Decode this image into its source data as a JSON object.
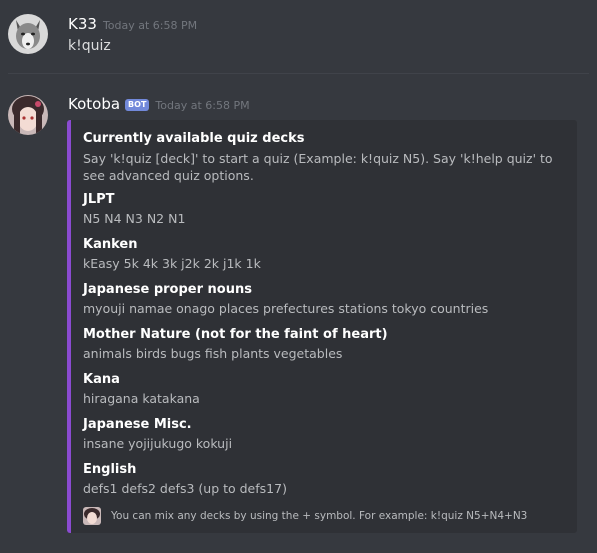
{
  "messages": [
    {
      "author": "K33",
      "timestamp": "Today at 6:58 PM",
      "content": "k!quiz"
    },
    {
      "author": "Kotoba",
      "bot_tag": "BOT",
      "timestamp": "Today at 6:58 PM"
    }
  ],
  "embed": {
    "accent_color": "#8b4bd1",
    "title": "Currently available quiz decks",
    "description": "Say 'k!quiz [deck]' to start a quiz (Example: k!quiz N5). Say 'k!help quiz' to see advanced quiz options.",
    "fields": [
      {
        "name": "JLPT",
        "value": "N5 N4 N3 N2 N1"
      },
      {
        "name": "Kanken",
        "value": "kEasy 5k 4k 3k j2k 2k j1k 1k"
      },
      {
        "name": "Japanese proper nouns",
        "value": "myouji namae onago places prefectures stations tokyo countries"
      },
      {
        "name": "Mother Nature (not for the faint of heart)",
        "value": "animals birds bugs fish plants vegetables"
      },
      {
        "name": "Kana",
        "value": "hiragana katakana"
      },
      {
        "name": "Japanese Misc.",
        "value": "insane yojijukugo kokuji"
      },
      {
        "name": "English",
        "value": "defs1 defs2 defs3 (up to defs17)"
      }
    ],
    "footer": "You can mix any decks by using the + symbol. For example: k!quiz N5+N4+N3"
  },
  "icons": {
    "k33_avatar": "wolf-avatar-icon",
    "kotoba_avatar": "anime-girl-avatar-icon",
    "footer_icon": "kotoba-footer-icon"
  },
  "colors": {
    "background": "#36393f",
    "embed_background": "#2f3136",
    "bot_tag": "#7289da",
    "timestamp": "#72767d"
  }
}
